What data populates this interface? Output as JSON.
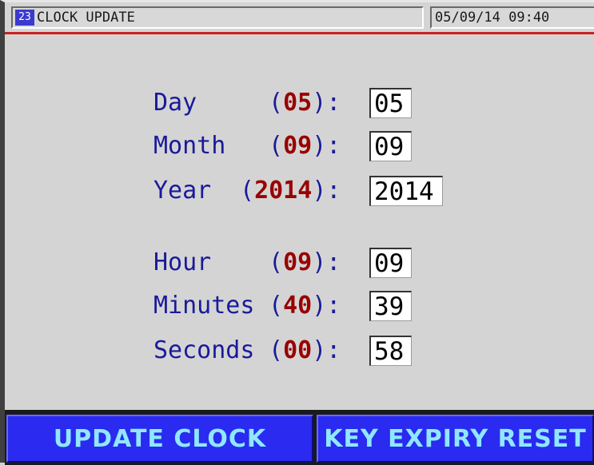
{
  "header": {
    "screen_number": "23",
    "title": "CLOCK UPDATE",
    "datetime": "05/09/14  09:40"
  },
  "fields": [
    {
      "label": "Day",
      "current": "05",
      "value": "05"
    },
    {
      "label": "Month",
      "current": "09",
      "value": "09"
    },
    {
      "label": "Year",
      "current": "2014",
      "value": "2014"
    },
    {
      "label": "Hour",
      "current": "09",
      "value": "09"
    },
    {
      "label": "Minutes",
      "current": "40",
      "value": "39"
    },
    {
      "label": "Seconds",
      "current": "00",
      "value": "58"
    }
  ],
  "buttons": {
    "update_clock": "UPDATE CLOCK",
    "key_expiry_reset": "KEY EXPIRY RESET"
  },
  "colors": {
    "button_bg": "#2a2af0",
    "button_text": "#8fe8ff",
    "label_text": "#1a1a9a",
    "current_value_text": "#990000",
    "accent_line": "#c82020"
  }
}
